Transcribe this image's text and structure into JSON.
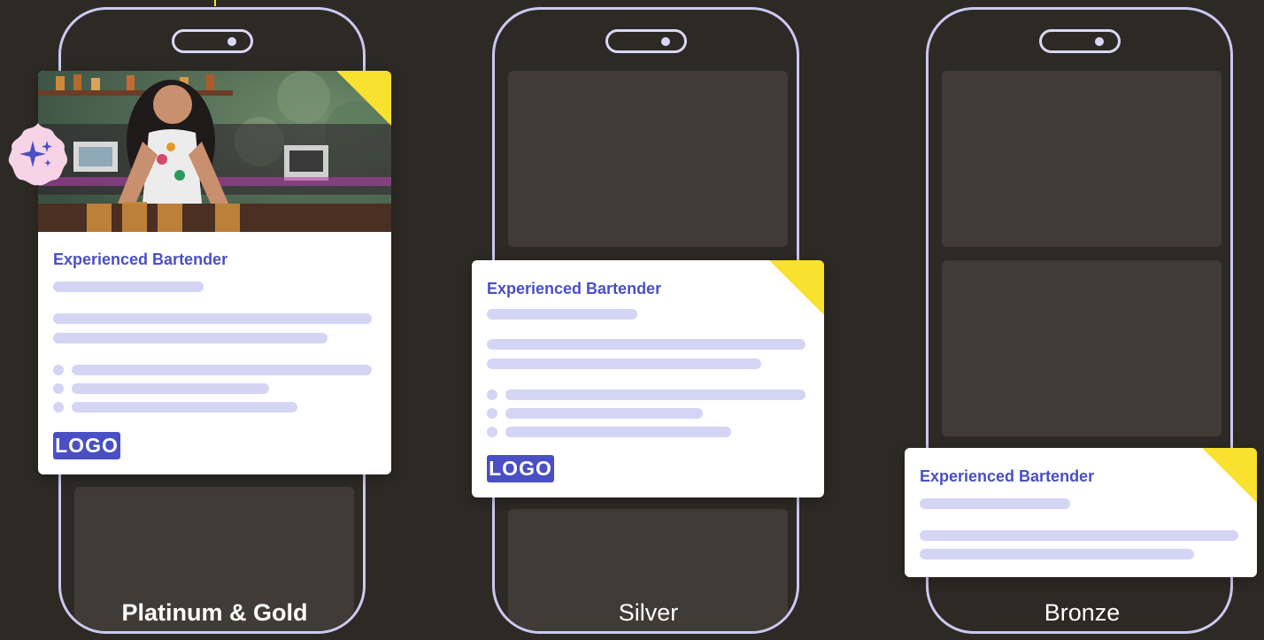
{
  "tiers": [
    {
      "label": "Platinum & Gold"
    },
    {
      "label": "Silver"
    },
    {
      "label": "Bronze"
    }
  ],
  "card": {
    "title": "Experienced Bartender",
    "logo": "LOGO"
  },
  "colors": {
    "background": "#2d2925",
    "phone_outline": "#c9c9f0",
    "placeholder_slot": "#403b36",
    "accent": "#4a4fc4",
    "skeleton": "#d4d4f4",
    "corner_flag": "#f8e12f",
    "badge": "#f6d3e6"
  },
  "icons": {
    "badge": "sparkle-icon"
  }
}
